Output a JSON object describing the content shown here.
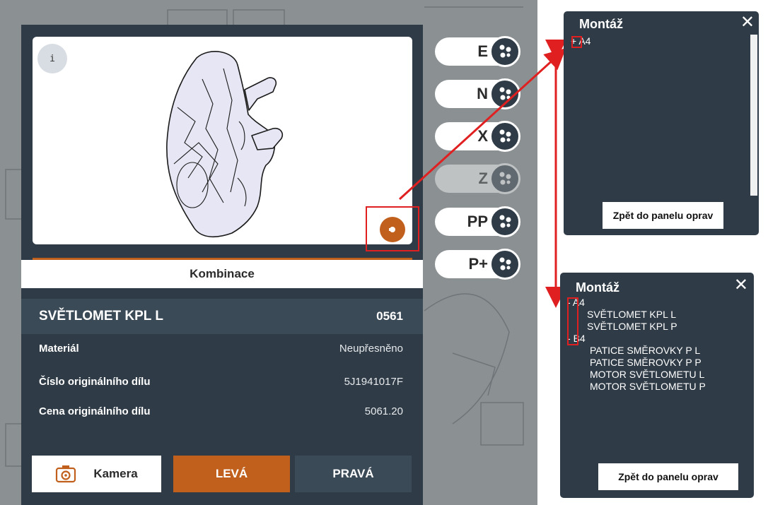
{
  "part": {
    "info_icon": "i",
    "combination_label": "Kombinace",
    "name": "SVĚTLOMET KPL L",
    "code": "0561",
    "details": [
      {
        "label": "Materiál",
        "value": "Neupřesněno"
      },
      {
        "label": "Číslo originálního dílu",
        "value": "5J1941017F"
      },
      {
        "label": "Cena originálního dílu",
        "value": "5061.20"
      }
    ]
  },
  "bottom_buttons": {
    "camera": "Kamera",
    "left": "LEVÁ",
    "right": "PRAVÁ"
  },
  "letter_buttons": [
    {
      "label": "E",
      "enabled": true
    },
    {
      "label": "N",
      "enabled": true
    },
    {
      "label": "X",
      "enabled": true
    },
    {
      "label": "Z",
      "enabled": false
    },
    {
      "label": "PP",
      "enabled": true
    },
    {
      "label": "P+",
      "enabled": true
    }
  ],
  "montaz_collapsed": {
    "title": "Montáž",
    "close": "✕",
    "items": [
      {
        "marker": "+",
        "label": "A4"
      }
    ],
    "return_button": "Zpět do panelu oprav"
  },
  "montaz_expanded": {
    "title": "Montáž",
    "close": "✕",
    "groups": [
      {
        "marker": "-",
        "label": "A4",
        "children": [
          "SVĚTLOMET KPL L",
          "SVĚTLOMET KPL P"
        ]
      },
      {
        "marker": "-",
        "label": "B4",
        "children": [
          "PATICE SMĚROVKY P L",
          "PATICE SMĚROVKY P P",
          "MOTOR SVĚTLOMETU L",
          "MOTOR SVĚTLOMETU P"
        ]
      }
    ],
    "return_button": "Zpět do panelu oprav"
  },
  "colors": {
    "accent": "#c0601c",
    "panel": "#2f3b46",
    "highlight": "#e02020"
  },
  "icons": [
    "info-icon",
    "combination-icon",
    "camera-icon",
    "close-icon",
    "scatter-icon"
  ]
}
